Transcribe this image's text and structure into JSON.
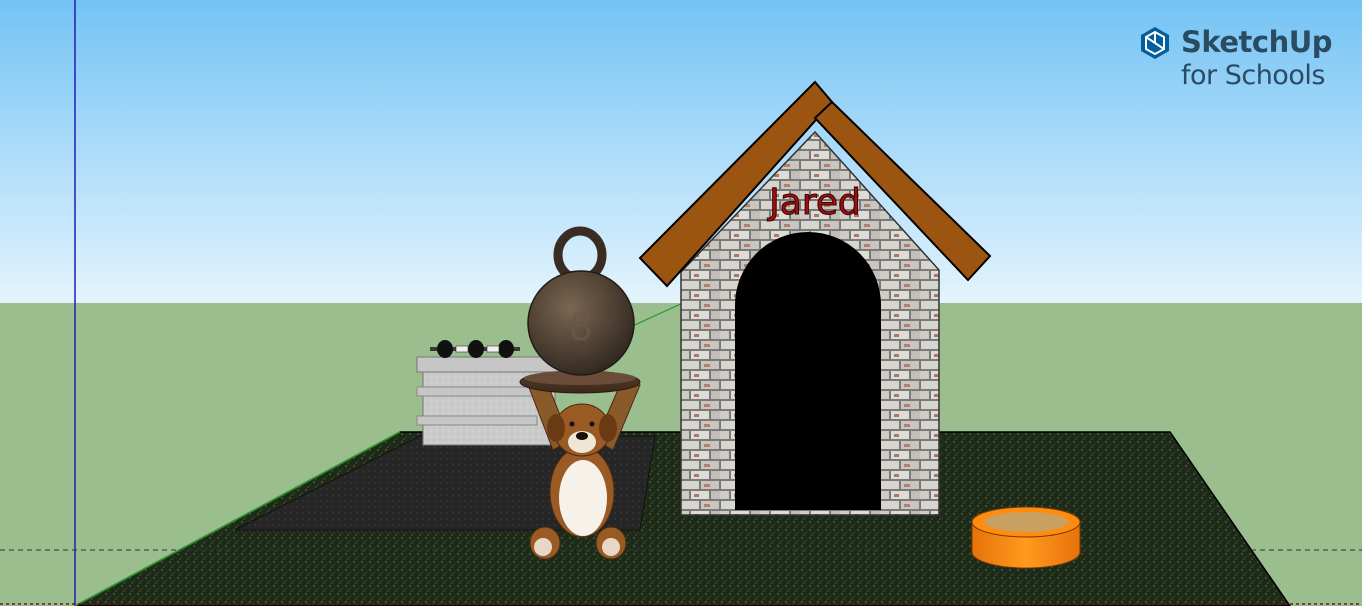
{
  "app": {
    "brand_title": "SketchUp",
    "brand_subtitle": "for Schools"
  },
  "scene": {
    "doghouse_sign": "Jared"
  },
  "icons": [
    "sketchup-logo-icon"
  ],
  "colors": {
    "sky_top": "#74c3f4",
    "sky_bottom": "#e4f4fd",
    "ground": "#9bbe8e",
    "roof": "#9c5511",
    "sign_text": "#a01010",
    "bowl": "#ff8c10",
    "axis_blue": "#1e1eb4",
    "axis_green": "#2a9a2a"
  }
}
